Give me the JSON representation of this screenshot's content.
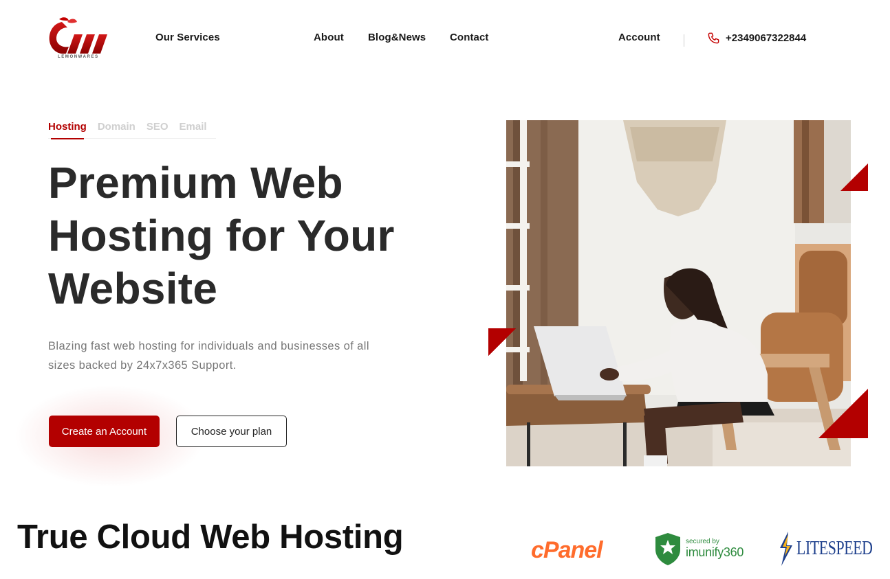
{
  "header": {
    "logo_text": "LEMONWARES",
    "nav": {
      "services": "Our Services",
      "about": "About",
      "blog": "Blog&News",
      "contact": "Contact",
      "account": "Account"
    },
    "phone": "+2349067322844"
  },
  "tabs": [
    "Hosting",
    "Domain",
    "SEO",
    "Email"
  ],
  "hero": {
    "title": "Premium Web Hosting for Your Website",
    "subtitle": "Blazing fast web hosting for individuals and businesses of all sizes backed by 24x7x365 Support.",
    "primary_button": "Create an Account",
    "secondary_button": "Choose your plan"
  },
  "section": {
    "title": "True Cloud Web Hosting"
  },
  "partners": {
    "cpanel": "cPanel",
    "imunify_small": "secured by",
    "imunify_big": "imunify360",
    "litespeed": "LITESPEED"
  },
  "colors": {
    "brand": "#b30000",
    "text_dark": "#2a2a2a",
    "text_muted": "#777777",
    "tab_inactive": "#cfcfcf",
    "cpanel": "#ff6c2c",
    "imunify": "#2e8b3e",
    "litespeed": "#1d3f8c"
  }
}
